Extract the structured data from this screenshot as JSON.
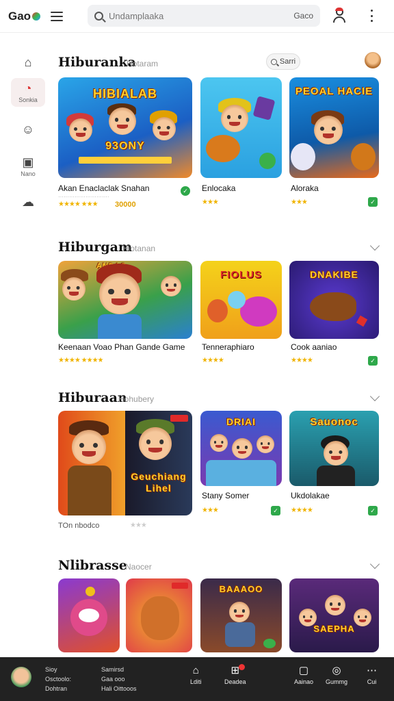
{
  "header": {
    "logo": "Gao",
    "search_placeholder": "Undamplaaka",
    "search_button": "Gaco"
  },
  "sidebar": {
    "items": [
      {
        "label": "",
        "icon": "home-icon"
      },
      {
        "label": "Sonkia",
        "icon": "game-icon",
        "active": true
      },
      {
        "label": "",
        "icon": "chat-icon"
      },
      {
        "label": "Nano",
        "icon": "tv-icon"
      },
      {
        "label": "",
        "icon": "cloud-icon"
      }
    ]
  },
  "sections": [
    {
      "title": "Hiburanka",
      "subtitle": "Hotaram",
      "pill": "Sarri",
      "cards": [
        {
          "title": "Akan Enaclaclak Snahan",
          "stars": "★★★★ ★★★",
          "price": "30000",
          "meta": "",
          "art_text": "HIBIALAB",
          "art_sub": "93ONY"
        },
        {
          "title": "Enlocaka",
          "stars": "★★★",
          "art_text": ""
        },
        {
          "title": "Aloraka",
          "stars": "★★★",
          "art_text": "PEOAL HACIE"
        }
      ]
    },
    {
      "title": "Hiburgam",
      "subtitle": "Hiotanan",
      "cards": [
        {
          "title": "Keenaan Voao Phan Gande Game",
          "stars": "★★★★  ★★★★",
          "art_text": "ANDAS"
        },
        {
          "title": "Tenneraphiaro",
          "stars": "★★★★",
          "art_text": "FIOLUS"
        },
        {
          "title": "Cook aaniao",
          "stars": "★★★★",
          "art_text": "DNAKIBE"
        }
      ]
    },
    {
      "title": "Hiburaan",
      "subtitle": "Hohubery",
      "cards": [
        {
          "title": "",
          "footer": "TOn nbodco",
          "art_text": "Geuchiang Lihel"
        },
        {
          "title": "Stany Somer",
          "stars": "★★★",
          "art_text": "DRIAI"
        },
        {
          "title": "Ukdolakae",
          "stars": "★★★★",
          "art_text": "Sauonoc"
        }
      ]
    },
    {
      "title": "Nlibrasse",
      "subtitle": "Naocer",
      "cards": [
        {
          "art_text": ""
        },
        {
          "art_text": ""
        },
        {
          "art_text": "BAAAOO"
        },
        {
          "art_text": "SAEPHA"
        }
      ]
    }
  ],
  "bottom_bar": {
    "user_line1": "Sioy",
    "user_line2": "Osctoolo:",
    "user_line3": "Dohtran",
    "info_line1": "Samirsd",
    "info_line2": "Gaa ooo",
    "info_line3": "Hali Oittooos",
    "tabs": [
      {
        "label": "Lditi",
        "icon": "home-icon"
      },
      {
        "label": "Deadea",
        "icon": "game-icon"
      },
      {
        "label": "Aainao",
        "icon": "square-icon"
      },
      {
        "label": "Gummg",
        "icon": "compass-icon"
      },
      {
        "label": "Cui",
        "icon": "more-icon"
      }
    ]
  },
  "colors": {
    "accent": "#d33333",
    "badge": "#2ea84a",
    "star": "#f0b400",
    "bottom": "#222222"
  }
}
